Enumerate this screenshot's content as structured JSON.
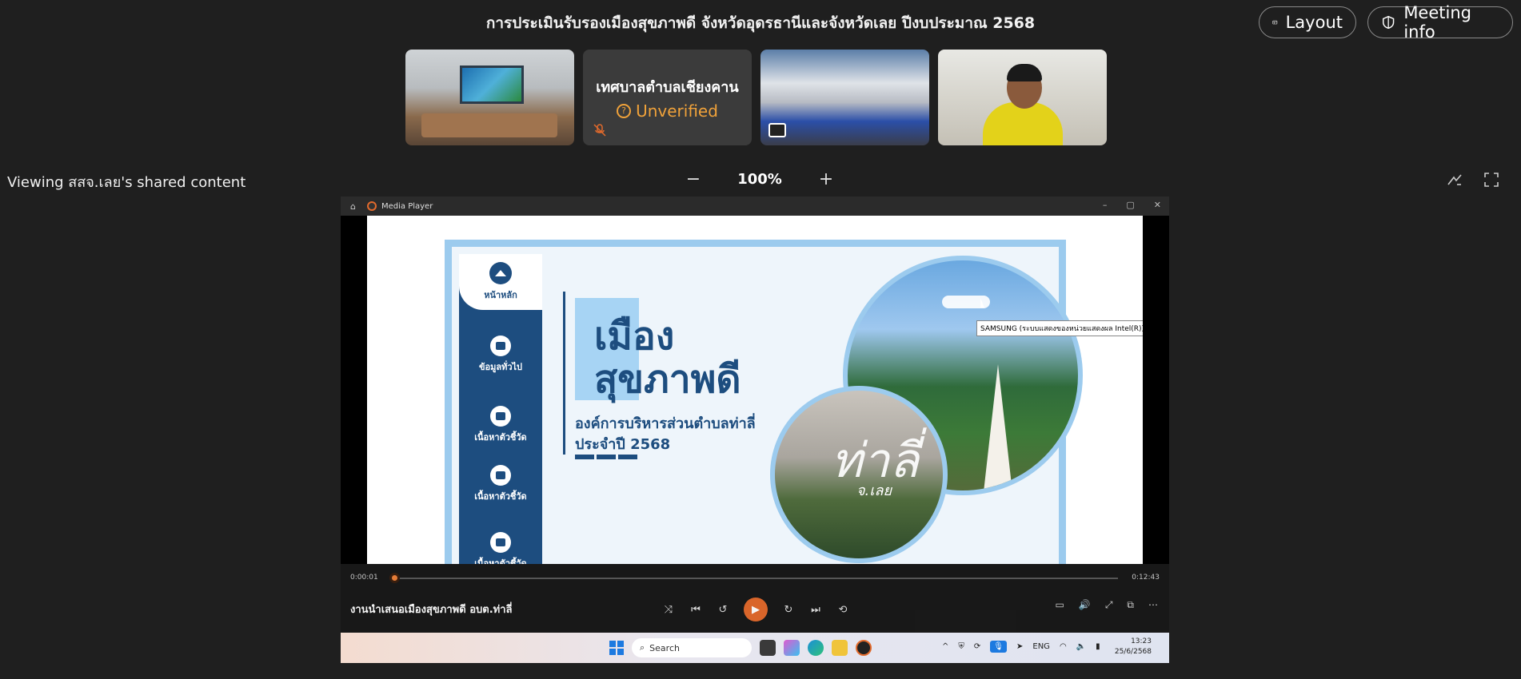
{
  "meeting": {
    "title": "การประเมินรับรองเมืองสุขภาพดี จังหวัดอุดรธานีและจังหวัดเลย ปีงบประมาณ 2568",
    "layout_label": "Layout",
    "meeting_info_label": "Meeting info"
  },
  "participants": [
    {
      "type": "video",
      "scene": "meeting room with board"
    },
    {
      "type": "avatar",
      "name": "เทศบาลตำบลเชียงคาน",
      "status": "Unverified",
      "muted": true
    },
    {
      "type": "video",
      "scene": "conference room",
      "sharing": true
    },
    {
      "type": "video",
      "scene": "person in yellow shirt"
    }
  ],
  "share": {
    "viewing_label": "Viewing สสจ.เลย's shared content",
    "zoom": "100%",
    "zoom_out": "−",
    "zoom_in": "+"
  },
  "media_player": {
    "title": "Media Player",
    "current_time": "0:00:01",
    "total_time": "0:12:43",
    "progress": 0.0013,
    "media_name": "งานนำเสนอเมืองสุขภาพดี อบต.ท่าลี่",
    "tooltip": "SAMSUNG (ระบบแสดงของหน่วยแสดงผล Intel(R)) (HDMI)"
  },
  "slide": {
    "nav": [
      "หน้าหลัก",
      "ข้อมูลทั่วไป",
      "เนื้อหาตัวชี้วัด",
      "เนื้อหาตัวชี้วัด",
      "เนื้อหาตัวชี้วัด"
    ],
    "heading_line1": "เมือง",
    "heading_line2": "สุขภาพดี",
    "org": "องค์การบริหารส่วนตำบลท่าลี่",
    "year": "ประจำปี 2568",
    "photo_text": "ท่าลี่",
    "photo_sub": "จ.เลย"
  },
  "taskbar": {
    "search": "Search",
    "lang": "ENG",
    "time": "13:23",
    "date": "25/6/2568"
  },
  "colors": {
    "background": "#1f1f1f",
    "unverified": "#f0a23a",
    "slide_blue": "#1d4d7f",
    "accent_orange": "#e26a2c"
  }
}
